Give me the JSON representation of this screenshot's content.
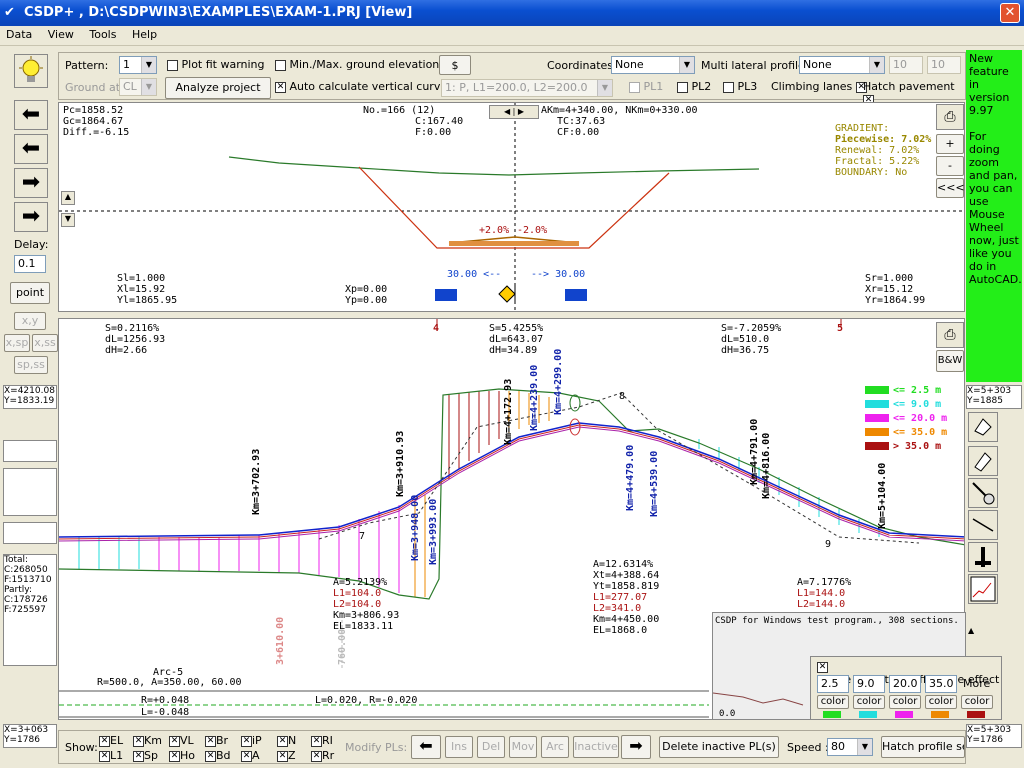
{
  "window": {
    "title": "CSDP+ , D:\\CSDPWIN3\\EXAMPLES\\EXAM-1.PRJ [View]",
    "close": "✕"
  },
  "menu": [
    "Data",
    "View",
    "Tools",
    "Help"
  ],
  "toolbar": {
    "pattern_label": "Pattern:",
    "pattern_value": "1",
    "ground_label": "Ground at:",
    "ground_value": "CL",
    "plot_fit_label": "Plot fit warning",
    "minmax_label": "Min./Max. ground elevations",
    "dollar_label": "$",
    "analyze_label": "Analyze project",
    "auto_calc_label": "Auto calculate vertical curves",
    "profile_formula": "1: P, L1=200.0, L2=200.0",
    "coordinates_label": "Coordinates:",
    "coordinates_value": "None",
    "multi_label": "Multi lateral profiles:",
    "multi_value": "None",
    "multi_a": "10",
    "multi_b": "10",
    "pl1": "PL1",
    "pl2": "PL2",
    "pl3": "PL3",
    "climbing": "Climbing lanes",
    "hatch_pavement": "Hatch pavement"
  },
  "green_info": "New feature in version 9.97\n\nFor doing zoom and pan, you can use Mouse Wheel now, just like you do in AutoCAD.",
  "left": {
    "delay_label": "Delay:",
    "delay_value": "0.1",
    "point_label": "point",
    "xy_label": "x,y",
    "xsp_label": "x,sp",
    "xss_label": "x,ss",
    "spss_label": "sp,ss"
  },
  "left_coords_1": "X=4210.08\nY=1833.19",
  "left_totals": "Total:\nC:268050\nF:1513710\nPartly:\nC:178726\nF:725597",
  "left_coords_2": "X=3+063\nY=1786",
  "right_coords_1": "X=5+303\nY=1885",
  "right_coords_2": "X=5+303\nY=1786",
  "cross": {
    "pc": "Pc=1858.52",
    "gc": "Gc=1864.67",
    "diff": "Diff.=-6.15",
    "no": "No.=166 (12)",
    "c": "C:167.40",
    "f": "F:0.00",
    "akm": "AKm=4+340.00, NKm=0+330.00",
    "tc": "TC:37.63",
    "cf": "CF:0.00",
    "gradient_title": "GRADIENT:",
    "piecewise": "Piecewise: 7.02%",
    "renewal": "Renewal:  7.02%",
    "fractal": "Fractal:  5.22%",
    "boundary": "BOUNDARY: No",
    "slope_left": "+2.0%",
    "slope_right": "-2.0%",
    "width_left": "30.00 <--",
    "width_right": "--> 30.00",
    "sl": "Sl=1.000",
    "xl": "Xl=15.92",
    "yl": "Yl=1865.95",
    "xp": "Xp=0.00",
    "yp": "Yp=0.00",
    "sr": "Sr=1.000",
    "xr": "Xr=15.12",
    "yr": "Yr=1864.99"
  },
  "profile": {
    "seg1_s": "S=0.2116%",
    "seg1_dl": "dL=1256.93",
    "seg1_dh": "dH=2.66",
    "seg2_s": "S=5.4255%",
    "seg2_dl": "dL=643.07",
    "seg2_dh": "dH=34.89",
    "seg3_s": "S=-7.2059%",
    "seg3_dl": "dL=510.0",
    "seg3_dh": "dH=36.75",
    "km4": "4",
    "km5": "5",
    "stations": [
      "Km=3+702.93",
      "Km=3+910.93",
      "Km=3+948.00",
      "Km=3+993.00",
      "Km=4+172.93",
      "Km=4+239.00",
      "Km=4+299.00",
      "Km=4+479.00",
      "Km=4+539.00",
      "Km=4+791.00",
      "Km=4+816.00",
      "Km=5+104.00"
    ],
    "pt7": "7",
    "pt8": "8",
    "pt9": "9",
    "vc1": [
      "A=5.2139%",
      "L1=104.0",
      "L2=104.0",
      "Km=3+806.93",
      "EL=1833.11"
    ],
    "vc2": [
      "A=12.6314%",
      "Xt=4+388.64",
      "Yt=1858.819",
      "L1=277.07",
      "L2=341.0",
      "Km=4+450.00",
      "EL=1868.0"
    ],
    "vc3": [
      "A=7.1776%",
      "L1=144.0",
      "L2=144.0"
    ],
    "vert1": "3+610.00",
    "vert2": "760.00",
    "arc_label": "Arc-5",
    "arc_params": "R=500.0, A=350.00, 60.00",
    "r_label": "R=+0.048",
    "l_label": "L=-0.048",
    "lr_label": "L=0.020, R=-0.020",
    "legend": [
      {
        "label": "<= 2.5 m",
        "color": "#22dd22"
      },
      {
        "label": "<= 9.0 m",
        "color": "#22dddd"
      },
      {
        "label": "<= 20.0 m",
        "color": "#ee22ee"
      },
      {
        "label": "<= 35.0 m",
        "color": "#ee8800"
      },
      {
        "label": ">  35.0 m",
        "color": "#aa1111"
      }
    ]
  },
  "info_panel": {
    "text": "CSDP for Windows test program., 308 sections.",
    "zero": "0.0"
  },
  "elev_panel": {
    "title": "Profile elevation difference effect",
    "v1": "2.5",
    "v2": "9.0",
    "v3": "20.0",
    "v4": "35.0",
    "more": "More",
    "color_label": "color"
  },
  "bottom": {
    "show_label": "Show:",
    "checks_top": [
      "EL",
      "Km",
      "VL",
      "Br",
      "iP",
      "N",
      "RI"
    ],
    "checks_bot": [
      "L1",
      "Sp",
      "Ho",
      "Bd",
      "A",
      "Z",
      "Rr"
    ],
    "modify_label": "Modify PLs:",
    "ins": "Ins",
    "del": "Del",
    "mov": "Mov",
    "arc": "Arc",
    "inactive": "Inactive",
    "delete_inactive": "Delete inactive PL(s)",
    "speed_label": "Speed :",
    "speed_value": "80",
    "hatch_profile": "Hatch profile set"
  },
  "side_buttons": {
    "plus": "+",
    "minus": "-",
    "back": "<<<",
    "bw": "B&W"
  },
  "colors": {
    "green": "#22dd22",
    "cyan": "#22dddd",
    "magenta": "#ee22ee",
    "orange": "#ee8800",
    "darkred": "#aa1111"
  }
}
